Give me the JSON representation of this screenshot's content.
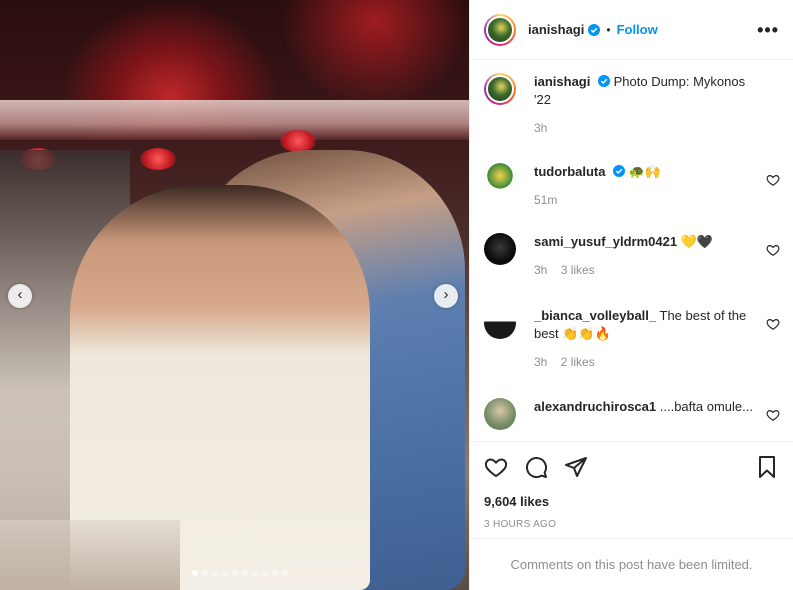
{
  "post": {
    "username": "ianishagi",
    "follow_label": "Follow",
    "separator": "•",
    "more_label": "•••",
    "caption": "Photo Dump: Mykonos '22",
    "caption_time": "3h",
    "carousel": {
      "total": 10,
      "active_index": 0
    },
    "nav_prev": "‹",
    "nav_next": "›"
  },
  "comments": [
    {
      "username": "tudorbaluta",
      "verified": true,
      "text": "🐢🙌",
      "time": "51m",
      "likes": ""
    },
    {
      "username": "sami_yusuf_yldrm0421",
      "verified": false,
      "text": "💛🖤",
      "time": "3h",
      "likes": "3 likes"
    },
    {
      "username": "_bianca_volleyball_",
      "verified": false,
      "text": "The best of the best 👏👏🔥",
      "time": "3h",
      "likes": "2 likes"
    },
    {
      "username": "alexandruchirosca1",
      "verified": false,
      "text": "....bafta omule...",
      "time": "",
      "likes": ""
    }
  ],
  "actions": {
    "likes_count": "9,604 likes",
    "timestamp": "3 hours ago",
    "comments_limited": "Comments on this post have been limited."
  },
  "colors": {
    "accent": "#0095f6",
    "muted": "#8e8e8e",
    "text": "#262626"
  },
  "icons": [
    "heart-icon",
    "comment-icon",
    "share-icon",
    "bookmark-icon",
    "verified-badge-icon",
    "more-icon"
  ]
}
